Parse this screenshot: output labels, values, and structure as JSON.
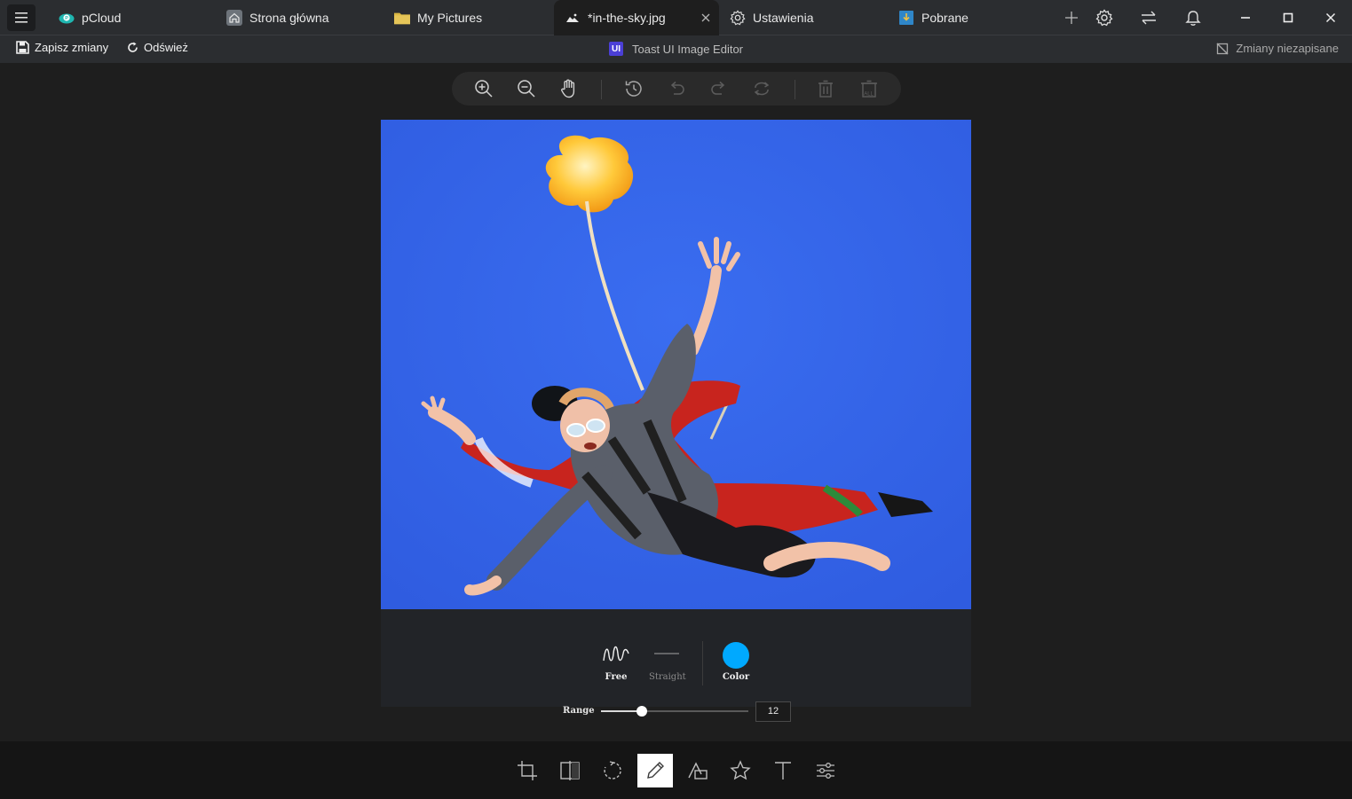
{
  "tabs": [
    {
      "label": "pCloud"
    },
    {
      "label": "Strona główna"
    },
    {
      "label": "My Pictures"
    },
    {
      "label": "*in-the-sky.jpg"
    },
    {
      "label": "Ustawienia"
    },
    {
      "label": "Pobrane"
    }
  ],
  "toolbar": {
    "save_label": "Zapisz zmiany",
    "refresh_label": "Odśwież",
    "app_badge": "UI",
    "app_title": "Toast UI Image Editor",
    "status": "Zmiany niezapisane"
  },
  "top_tools": {
    "delete_all_label": "ALL"
  },
  "draw_panel": {
    "free_label": "Free",
    "straight_label": "Straight",
    "color_label": "Color",
    "color_value": "#00a9ff",
    "range_label": "Range",
    "range_value": "12",
    "range_min": 5,
    "range_max": 30
  },
  "colors": {
    "accent": "#00a9ff",
    "sky": "#3564e8"
  },
  "bottom_menu": [
    "crop-icon",
    "flip-icon",
    "rotate-icon",
    "draw-icon",
    "shape-icon",
    "icon-star",
    "text-icon",
    "filter-icon"
  ]
}
